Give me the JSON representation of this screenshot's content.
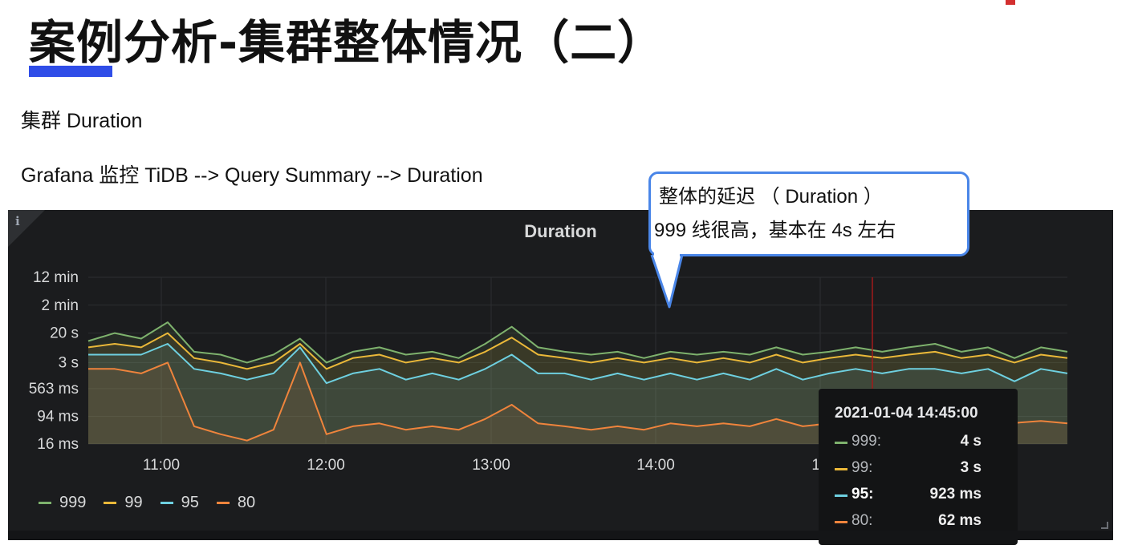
{
  "slide": {
    "title": "案例分析-集群整体情况（二）",
    "subtitle": "集群 Duration",
    "nav_path": "Grafana 监控 TiDB --> Query Summary --> Duration",
    "callout": {
      "line1": "整体的延迟 （ Duration ）",
      "line2": "999 线很高，基本在 4s 左右"
    }
  },
  "panel": {
    "title": "Duration",
    "info_icon": "i",
    "tooltip": {
      "time": "2021-01-04 14:45:00",
      "rows": [
        {
          "name": "999:",
          "value": "4 s",
          "color": "#7eb26d"
        },
        {
          "name": "99:",
          "value": "3 s",
          "color": "#eab839"
        },
        {
          "name": "95:",
          "value": "923 ms",
          "color": "#6ed0e0"
        },
        {
          "name": "80:",
          "value": "62 ms",
          "color": "#ef843c"
        }
      ]
    }
  },
  "chart_data": {
    "type": "line",
    "title": "Duration",
    "y_scale": "log",
    "y_ticks": [
      "12 min",
      "2 min",
      "20 s",
      "3 s",
      "563 ms",
      "94 ms",
      "16 ms"
    ],
    "x_ticks": [
      "11:00",
      "12:00",
      "13:00",
      "14:00",
      "15"
    ],
    "grid": true,
    "legend_position": "bottom-left",
    "series": [
      {
        "name": "999",
        "color": "#7eb26d",
        "values": [
          12,
          20,
          14,
          40,
          6,
          5,
          3,
          5,
          14,
          3,
          6,
          8,
          5,
          6,
          4,
          10,
          30,
          8,
          6,
          5,
          6,
          4,
          6,
          5,
          6,
          5,
          8,
          5,
          6,
          8,
          6,
          8,
          10,
          6,
          8,
          4,
          8,
          6
        ]
      },
      {
        "name": "99",
        "color": "#eab839",
        "values": [
          8,
          10,
          8,
          20,
          4,
          3,
          2,
          3,
          10,
          2,
          4,
          5,
          3,
          4,
          3,
          6,
          15,
          5,
          4,
          3,
          4,
          3,
          4,
          3,
          4,
          3,
          5,
          3,
          4,
          5,
          4,
          5,
          6,
          4,
          5,
          3,
          5,
          4
        ]
      },
      {
        "name": "95",
        "color": "#6ed0e0",
        "values": [
          5,
          5,
          5,
          10,
          2,
          1.5,
          1,
          1.5,
          8,
          0.8,
          1.5,
          2,
          1,
          1.5,
          1,
          2,
          5,
          1.5,
          1.5,
          1,
          1.5,
          1,
          1.5,
          1,
          1.5,
          1,
          2,
          1,
          1.5,
          2,
          1.5,
          2,
          2,
          1.5,
          2,
          0.9,
          2,
          1.5
        ]
      },
      {
        "name": "80",
        "color": "#ef843c",
        "values": [
          2,
          2,
          1.5,
          3,
          0.05,
          0.03,
          0.02,
          0.04,
          3,
          0.03,
          0.05,
          0.06,
          0.04,
          0.05,
          0.04,
          0.08,
          0.2,
          0.06,
          0.05,
          0.04,
          0.05,
          0.04,
          0.06,
          0.05,
          0.06,
          0.05,
          0.08,
          0.05,
          0.06,
          0.08,
          0.06,
          0.07,
          0.08,
          0.06,
          0.07,
          0.062,
          0.07,
          0.06
        ]
      }
    ]
  }
}
